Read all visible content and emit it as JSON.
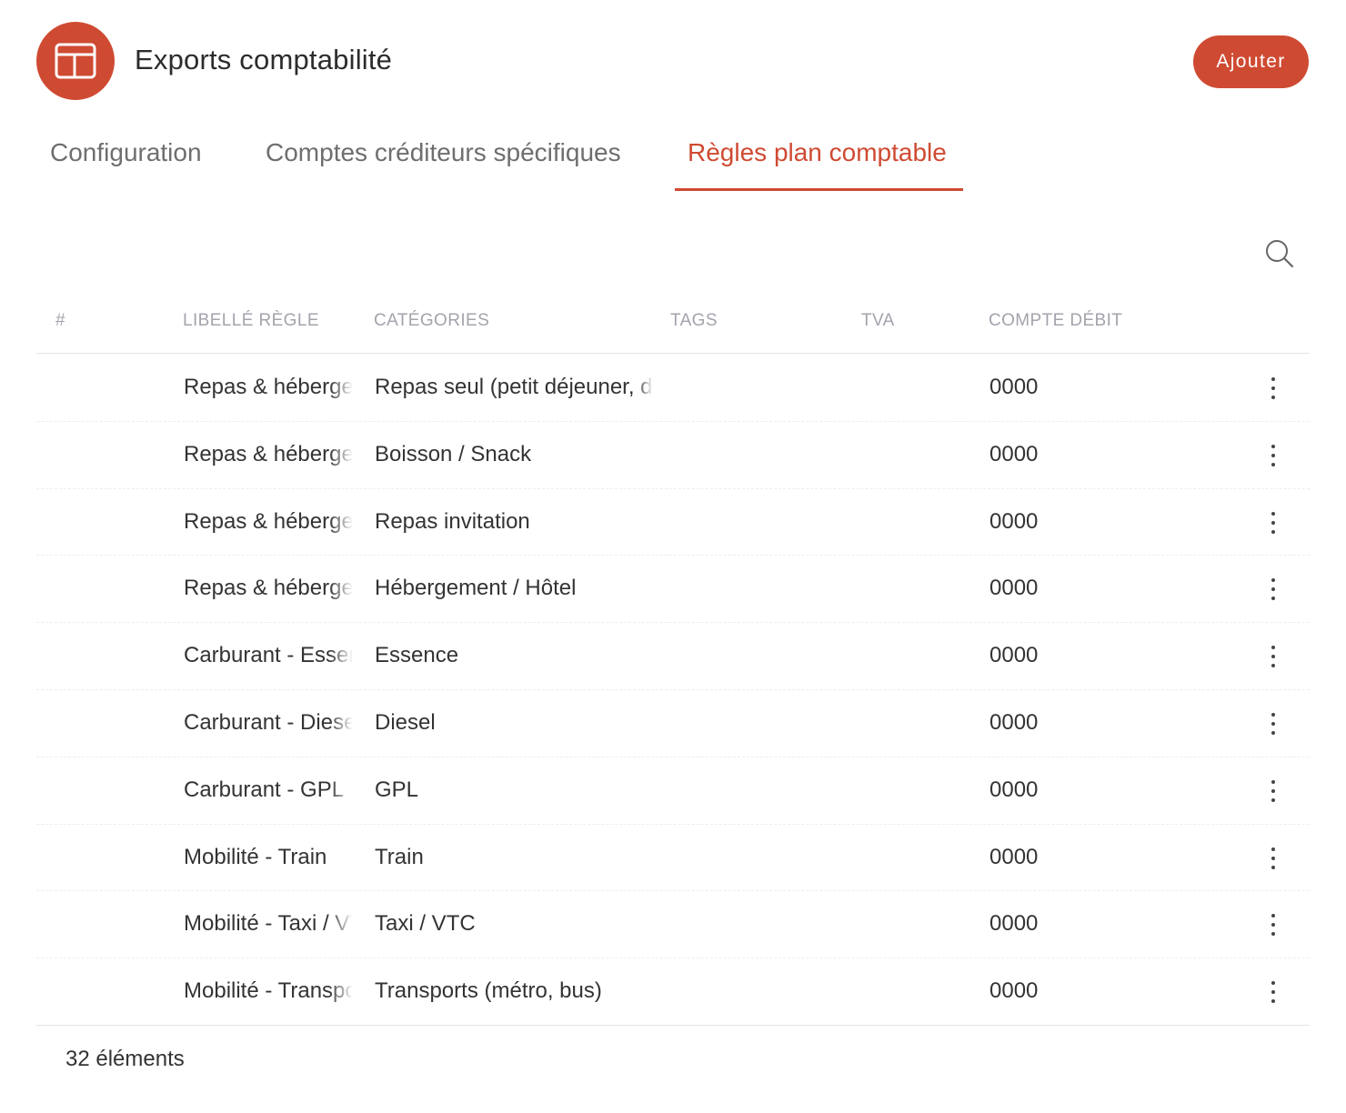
{
  "app": {
    "title": "Exports comptabilité",
    "accent_color": "#cf4a32",
    "logo_icon": "layout-icon"
  },
  "actions": {
    "add_label": "Ajouter"
  },
  "tabs": [
    {
      "label": "Configuration",
      "active": false
    },
    {
      "label": "Comptes créditeurs spécifiques",
      "active": false
    },
    {
      "label": "Règles plan comptable",
      "active": true
    }
  ],
  "table": {
    "columns": {
      "index": "#",
      "label": "LIBELLÉ RÈGLE",
      "categories": "CATÉGORIES",
      "tags": "TAGS",
      "vat": "TVA",
      "debit_account": "COMPTE DÉBIT"
    },
    "rows": [
      {
        "label": "Repas & hébergement",
        "category": "Repas seul (petit déjeuner, déjeuner)",
        "tags": "",
        "vat": "",
        "debit_account": "0000"
      },
      {
        "label": "Repas & hébergement",
        "category": "Boisson / Snack",
        "tags": "",
        "vat": "",
        "debit_account": "0000"
      },
      {
        "label": "Repas & hébergement",
        "category": "Repas invitation",
        "tags": "",
        "vat": "",
        "debit_account": "0000"
      },
      {
        "label": "Repas & hébergement",
        "category": "Hébergement / Hôtel",
        "tags": "",
        "vat": "",
        "debit_account": "0000"
      },
      {
        "label": "Carburant - Essence",
        "category": "Essence",
        "tags": "",
        "vat": "",
        "debit_account": "0000"
      },
      {
        "label": "Carburant - Diesel",
        "category": "Diesel",
        "tags": "",
        "vat": "",
        "debit_account": "0000"
      },
      {
        "label": "Carburant - GPL",
        "category": "GPL",
        "tags": "",
        "vat": "",
        "debit_account": "0000"
      },
      {
        "label": "Mobilité - Train",
        "category": "Train",
        "tags": "",
        "vat": "",
        "debit_account": "0000"
      },
      {
        "label": "Mobilité - Taxi / VTC",
        "category": "Taxi / VTC",
        "tags": "",
        "vat": "",
        "debit_account": "0000"
      },
      {
        "label": "Mobilité - Transports",
        "category": "Transports (métro, bus)",
        "tags": "",
        "vat": "",
        "debit_account": "0000"
      }
    ]
  },
  "footer": {
    "count_text": "32 éléments"
  }
}
